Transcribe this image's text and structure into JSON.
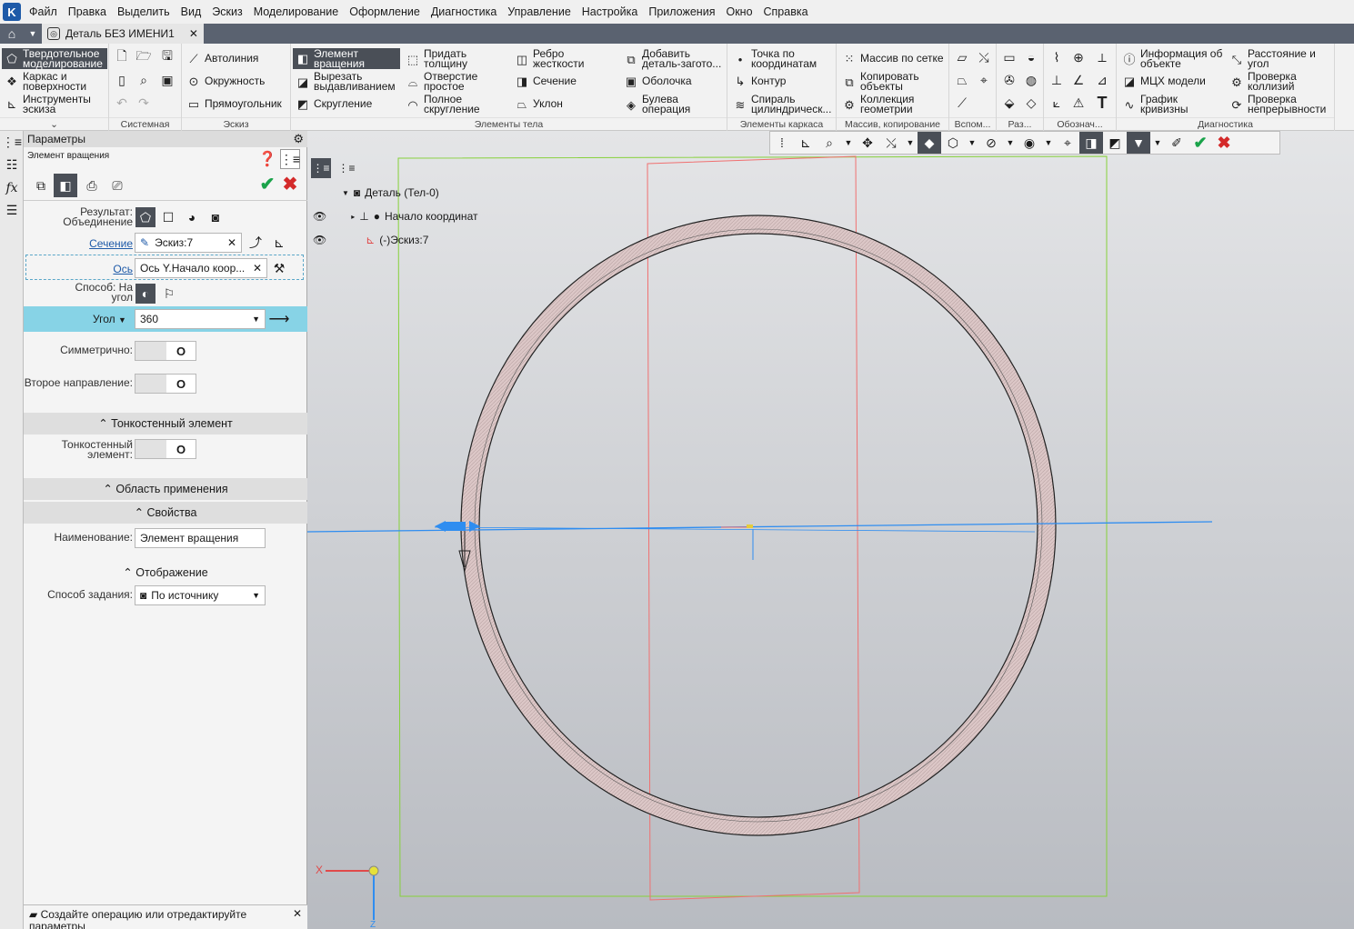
{
  "app": {
    "logo": "K"
  },
  "menu": [
    "Файл",
    "Правка",
    "Выделить",
    "Вид",
    "Эскиз",
    "Моделирование",
    "Оформление",
    "Диагностика",
    "Управление",
    "Настройка",
    "Приложения",
    "Окно",
    "Справка"
  ],
  "tab": {
    "title": "Деталь БЕЗ ИМЕНИ1",
    "close": "✕"
  },
  "ribbon": {
    "modes": [
      "Твердотельное моделирование",
      "Каркас и поверхности",
      "Инструменты эскиза"
    ],
    "groups": [
      "Системная",
      "Эскиз",
      "Элементы тела",
      "Элементы каркаса",
      "Массив, копирование",
      "Вспом...",
      "Раз...",
      "Обознач...",
      "Диагностика"
    ],
    "sketch": [
      "Автолиния",
      "Окружность",
      "Прямоугольник"
    ],
    "body1": [
      "Элемент вращения",
      "Вырезать выдавливанием",
      "Скругление"
    ],
    "body2": [
      "Придать толщину",
      "Отверстие простое",
      "Полное скругление"
    ],
    "body3": [
      "Ребро жесткости",
      "Сечение",
      "Уклон"
    ],
    "body4": [
      "Добавить деталь-загото...",
      "Оболочка",
      "Булева операция"
    ],
    "frame": [
      "Точка по координатам",
      "Контур",
      "Спираль цилиндрическ..."
    ],
    "array": [
      "Массив по сетке",
      "Копировать объекты",
      "Коллекция геометрии"
    ],
    "diag1": [
      "Информация об объекте",
      "МЦХ модели",
      "График кривизны"
    ],
    "diag2": [
      "Расстояние и угол",
      "Проверка коллизий",
      "Проверка непрерывности"
    ]
  },
  "panel": {
    "title": "Параметры",
    "subtitle": "Элемент вращения",
    "result_label": "Результат: Объединение",
    "section_label": "Сечение",
    "section_value": "Эскиз:7",
    "axis_label": "Ось",
    "axis_value": "Ось Y.Начало коор...",
    "method_label": "Способ: На угол",
    "angle_label": "Угол",
    "angle_value": "360",
    "symmetric_label": "Симметрично:",
    "second_dir_label": "Второе направление:",
    "thin_section": "Тонкостенный элемент",
    "thin_label": "Тонкостенный элемент:",
    "scope_section": "Область применения",
    "props_section": "Свойства",
    "name_label": "Наименование:",
    "name_value": "Элемент вращения",
    "display_section": "Отображение",
    "mode_label": "Способ задания:",
    "mode_value": "По источнику",
    "toggle_state": "O"
  },
  "tree": {
    "root": "Деталь (Тел-0)",
    "origin": "Начало координат",
    "sketch": "(-)Эскиз:7"
  },
  "status": {
    "message": "Создайте операцию или отредактируйте параметры"
  },
  "axes": {
    "x": "X",
    "z": "Z"
  },
  "colors": {
    "accent": "#1e5aa8",
    "highlight": "#87d3e6",
    "ok": "#1aa34a",
    "cancel": "#d42a2a",
    "ring": "#d8c3c3",
    "frame_green": "#86d13a",
    "frame_red": "#f07070"
  }
}
